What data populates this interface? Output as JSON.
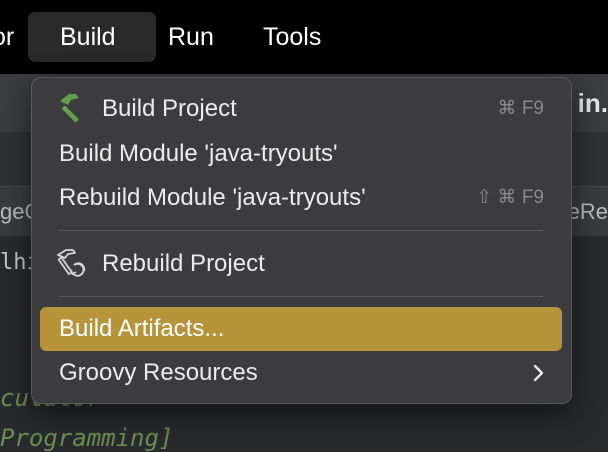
{
  "menubar": {
    "items": [
      {
        "label": "or"
      },
      {
        "label": "Build"
      },
      {
        "label": "Run"
      },
      {
        "label": "Tools"
      }
    ]
  },
  "background": {
    "tab_right_fragment": "in.",
    "tab_left_fragment": "geC",
    "tab_right_fragment2": "eRe",
    "code_line1": "lhi",
    "code_line2": "culator",
    "code_line3": "Programming]"
  },
  "build_menu": {
    "items": [
      {
        "label": "Build Project",
        "shortcut": "⌘ F9",
        "icon": "hammer-icon"
      },
      {
        "label": "Build Module 'java-tryouts'"
      },
      {
        "label": "Rebuild Module 'java-tryouts'",
        "shortcut": "⇧ ⌘ F9"
      },
      {
        "label": "Rebuild Project",
        "icon": "rebuild-hammer-icon"
      },
      {
        "label": "Build Artifacts..."
      },
      {
        "label": "Groovy Resources",
        "icon": "chevron-right-icon"
      }
    ],
    "highlight_color": "#b7943a"
  }
}
